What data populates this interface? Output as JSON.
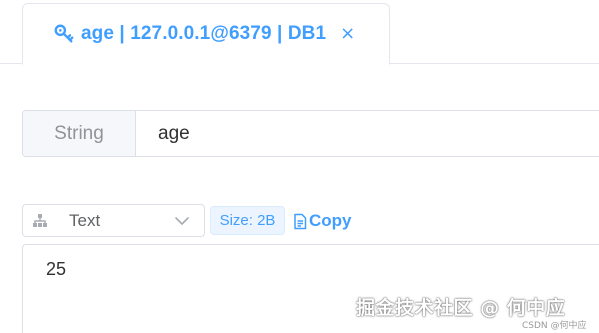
{
  "tab": {
    "label": "age | 127.0.0.1@6379 | DB1",
    "icon": "key-icon",
    "close_glyph": "×",
    "accent_color": "#409eff"
  },
  "key": {
    "type": "String",
    "name": "age"
  },
  "viewer": {
    "format": "Text",
    "icon": "viewer-icon",
    "size_tag": "Size: 2B",
    "copy_label": "Copy"
  },
  "value": {
    "content": "25"
  },
  "watermark": {
    "main": "掘金技术社区 @ 何中应",
    "sub": "CSDN @何中应"
  }
}
